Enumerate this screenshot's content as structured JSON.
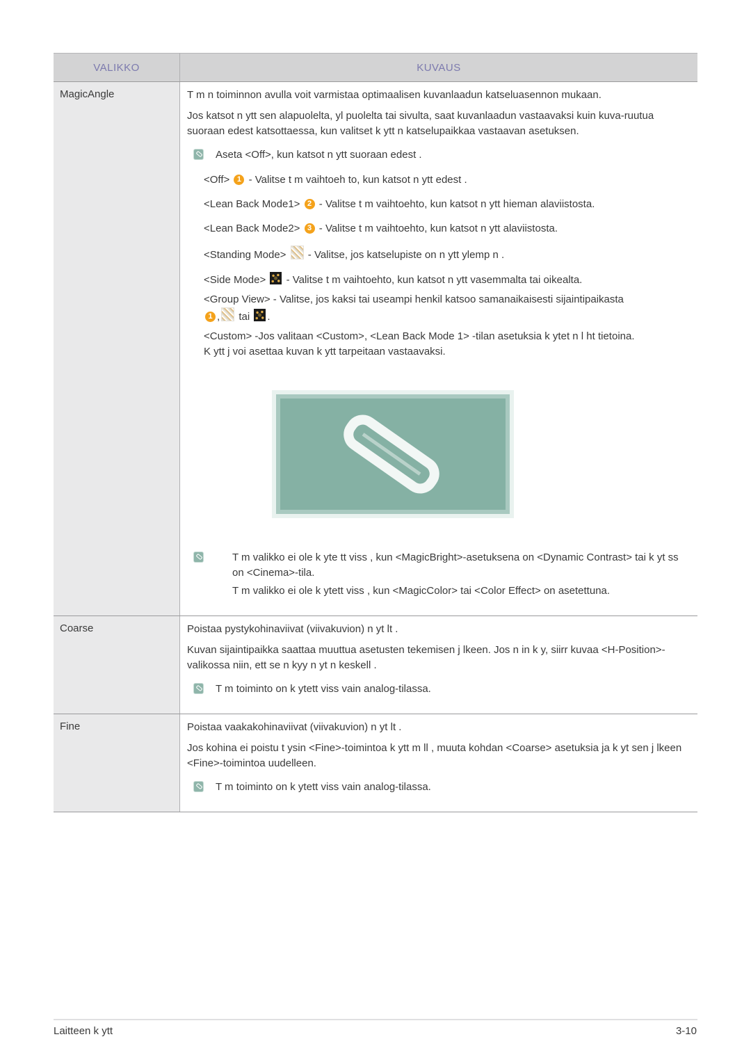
{
  "table": {
    "headers": {
      "menu": "VALIKKO",
      "description": "KUVAUS"
    },
    "colors": {
      "header_bg": "#d3d3d4",
      "header_text": "#7c7aae",
      "menu_col_bg": "#e9e9ea",
      "note_icon": "#8fb5aa",
      "badge": "#f4a21b"
    },
    "rows": [
      {
        "menu": "MagicAngle",
        "paragraphs": [
          "T m n toiminnon avulla voit varmistaa optimaalisen kuvanlaadun katseluasennon mukaan.",
          "Jos katsot n ytt   sen alapuolelta, yl puolelta tai     sivulta, saat kuvanlaadun vastaavaksi kuin kuva-ruutua suoraan edest  katsottaessa, kun valitset  k ytt  n katselupaikkaa vastaavan asetuksen."
        ],
        "note": "Aseta <Off>, kun katsot n ytt   suoraan edest .",
        "modes": [
          {
            "label": "<Off>",
            "icon": "badge-1-icon",
            "badge": "1",
            "text": "- Valitse t m  vaihtoeh  to, kun katsot n ytt   edest ."
          },
          {
            "label": "<Lean Back Mode1>",
            "icon": "badge-2-icon",
            "badge": "2",
            "text": "- Valitse t m  vaihtoehto, kun katsot n ytt   hieman alaviistosta."
          },
          {
            "label": "<Lean Back Mode2>",
            "icon": "badge-3-icon",
            "badge": "3",
            "text": "- Valitse t m  vaihtoehto, kun katsot n ytt   alaviistosta."
          },
          {
            "label": "<Standing Mode>",
            "icon": "standing-mode-icon",
            "text": "- Valitse, jos katselupiste on n ytt   ylemp n ."
          },
          {
            "label": "<Side Mode>",
            "icon": "side-mode-icon",
            "text": "- Valitse t m    vaihtoehto, kun katsot n ytt    vasemmalta tai oikealta."
          }
        ],
        "group_view": {
          "text": "<Group View> - Valitse, jos kaksi tai useampi henkil  katsoo samanaikaisesti sijaintipaikasta",
          "badge": "1",
          "comma": ",",
          "tai": "tai",
          "period": "."
        },
        "custom": [
          "<Custom> -Jos valitaan <Custom>, <Lean Back Mode 1> -tilan asetuksia k ytet  n l ht tietoina.",
          "K ytt j  voi asettaa kuvan k     ytt tarpeitaan  vastaavaksi."
        ],
        "notes": [
          "T m  valikko ei ole k yte    tt viss , kun <MagicBright>-asetuksena on <Dynamic Contrast> tai k yt ss  on <Cinema>-tila.",
          "T m  valikko ei ole k ytett viss , kun <MagicColor> tai <Color Effect> on asetettuna."
        ]
      },
      {
        "menu": "Coarse",
        "paragraphs": [
          "Poistaa pystykohinaviivat (viivakuvion) n yt lt .",
          "Kuvan sijaintipaikka saattaa muuttua asetusten tekemisen j lkeen. Jos n in k y, siirr  kuvaa <H-Position>-valikossa niin, ett  se n kyy n yt n keskell ."
        ],
        "note": "T m  toiminto on k ytett     viss  vain analog-tilassa."
      },
      {
        "menu": "Fine",
        "paragraphs": [
          "Poistaa vaakakohinaviivat (viivakuvion) n yt lt .",
          "Jos kohina ei poistu t ysin <Fine>-toimintoa k ytt     m ll , muuta kohdan <Coarse> asetuksia ja k yt sen j lkeen <Fine>-toimintoa uudelleen."
        ],
        "note": "T m  toiminto on k ytett     viss  vain analog-tilassa."
      }
    ]
  },
  "footer": {
    "section": "Laitteen k ytt",
    "page": "3-10"
  }
}
